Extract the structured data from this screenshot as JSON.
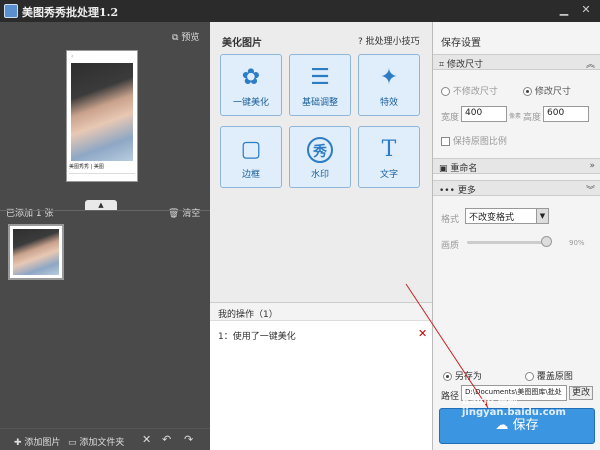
{
  "window": {
    "title": "美图秀秀批处理1.2",
    "minimize": "▁",
    "close": "✕"
  },
  "left_panel": {
    "preview_label": "预览",
    "phone_caption": "美图秀秀 | 美图",
    "added_count": "已添加 1 张",
    "clear_label": "清空",
    "footer": {
      "add_image": "添加图片",
      "add_folder": "添加文件夹"
    }
  },
  "middle_panel": {
    "beautify_header": "美化图片",
    "tips_link": "批处理小技巧",
    "tiles": [
      {
        "label": "一键美化",
        "icon": "tulip-icon",
        "glyph": "✿"
      },
      {
        "label": "基础调整",
        "icon": "sliders-icon",
        "glyph": "☰"
      },
      {
        "label": "特效",
        "icon": "magic-wand-icon",
        "glyph": "✦"
      },
      {
        "label": "边框",
        "icon": "frame-icon",
        "glyph": "▢"
      },
      {
        "label": "水印",
        "icon": "watermark-seal-icon",
        "glyph": "秀"
      },
      {
        "label": "文字",
        "icon": "text-icon",
        "glyph": "T"
      }
    ],
    "ops_header": "我的操作（1）",
    "op_item": "1：使用了一键美化"
  },
  "right_panel": {
    "title": "保存设置",
    "resize_section": "修改尺寸",
    "no_resize": "不修改尺寸",
    "do_resize": "修改尺寸",
    "width_label": "宽度",
    "width_value": "400",
    "width_unit": "像素",
    "height_label": "高度",
    "height_value": "600",
    "keep_ratio": "保持原图比例",
    "rename_section": "重命名",
    "more_section": "更多",
    "format_label": "格式",
    "format_value": "不改变格式",
    "quality_label": "画质",
    "quality_value": "90%",
    "quality_level": 0.9,
    "save_as": "另存为",
    "overwrite": "覆盖原图",
    "path_label": "路径",
    "path_value": "D:\\Documents\\美图图库\\批处",
    "change_label": "更改",
    "save_button": "保存"
  },
  "watermark_text": "Baidu 经验  jingyan.baidu.com",
  "colors": {
    "accent": "#3c95e0",
    "tile_bg": "#dfeefa",
    "close_red": "#cc0000",
    "arrow_red": "#cc2222"
  }
}
